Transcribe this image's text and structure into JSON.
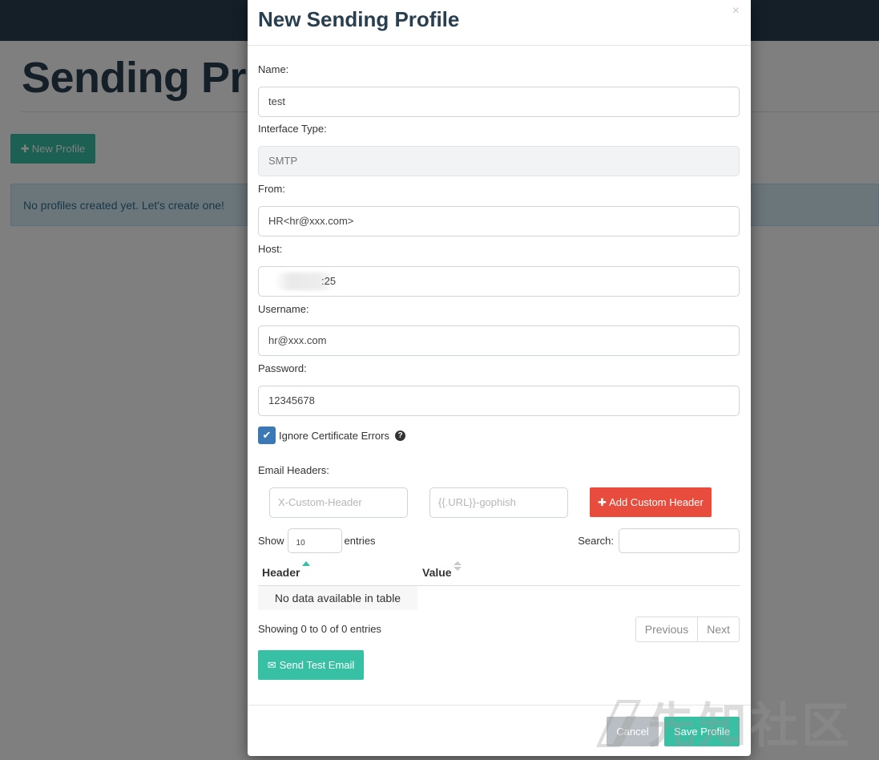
{
  "background": {
    "page_title": "Sending Pro",
    "new_profile_label": "New Profile",
    "alert_text": "No profiles created yet. Let's create one!"
  },
  "modal": {
    "title": "New Sending Profile",
    "close_symbol": "×",
    "fields": {
      "name_label": "Name:",
      "name_value": "test",
      "interface_label": "Interface Type:",
      "interface_value": "SMTP",
      "from_label": "From:",
      "from_value": "HR<hr@xxx.com>",
      "host_label": "Host:",
      "host_value": ":25",
      "username_label": "Username:",
      "username_value": "hr@xxx.com",
      "password_label": "Password:",
      "password_value": "12345678"
    },
    "ignore_cert": {
      "label": "Ignore Certificate Errors",
      "checked": true
    },
    "email_headers": {
      "label": "Email Headers:",
      "header_placeholder": "X-Custom-Header",
      "value_placeholder": "{{.URL}}-gophish",
      "add_button": "Add Custom Header"
    },
    "table": {
      "show_label": "Show",
      "entries_value": "10",
      "entries_label": "entries",
      "search_label": "Search:",
      "columns": [
        "Header",
        "Value"
      ],
      "empty_text": "No data available in table",
      "info_text": "Showing 0 to 0 of 0 entries",
      "pager": [
        "Previous",
        "Next"
      ]
    },
    "send_test_label": "Send Test Email",
    "cancel_label": "Cancel",
    "save_label": "Save Profile"
  },
  "watermark": {
    "text": "先知社区"
  },
  "colors": {
    "navbar": "#283f50",
    "primary_green": "#37c0a4",
    "danger_red": "#e84c3d",
    "checkbox_blue": "#3c78b4"
  }
}
